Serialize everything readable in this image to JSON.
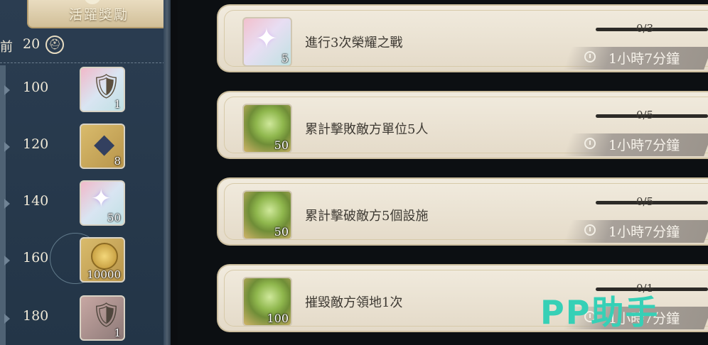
{
  "panel": {
    "title": "活躍獎勵",
    "current_label": "前",
    "current_value": "20",
    "current_icon": "helmet-icon"
  },
  "milestones": [
    {
      "points": "100",
      "reward_icon": "shield-sword-icon",
      "qty": "1"
    },
    {
      "points": "120",
      "reward_icon": "blue-crystal-icon",
      "qty": "8"
    },
    {
      "points": "140",
      "reward_icon": "star-gem-icon",
      "qty": "50"
    },
    {
      "points": "160",
      "reward_icon": "gold-coin-icon",
      "qty": "10000"
    },
    {
      "points": "180",
      "reward_icon": "shield-icon",
      "qty": "1"
    }
  ],
  "tasks": [
    {
      "desc": "進行3次榮耀之戰",
      "progress": "0/3",
      "time": "1小時7分鐘",
      "reward_icon": "star-gem-icon",
      "qty": "5"
    },
    {
      "desc": "累計擊敗敵方單位5人",
      "progress": "0/5",
      "time": "1小時7分鐘",
      "reward_icon": "green-orb-icon",
      "qty": "50"
    },
    {
      "desc": "累計擊破敵方5個設施",
      "progress": "0/5",
      "time": "1小時7分鐘",
      "reward_icon": "green-orb-icon",
      "qty": "50"
    },
    {
      "desc": "摧毀敵方領地1次",
      "progress": "0/1",
      "time": "1小時7分鐘",
      "reward_icon": "green-orb-icon",
      "qty": "100"
    }
  ],
  "watermark": "PP助手"
}
